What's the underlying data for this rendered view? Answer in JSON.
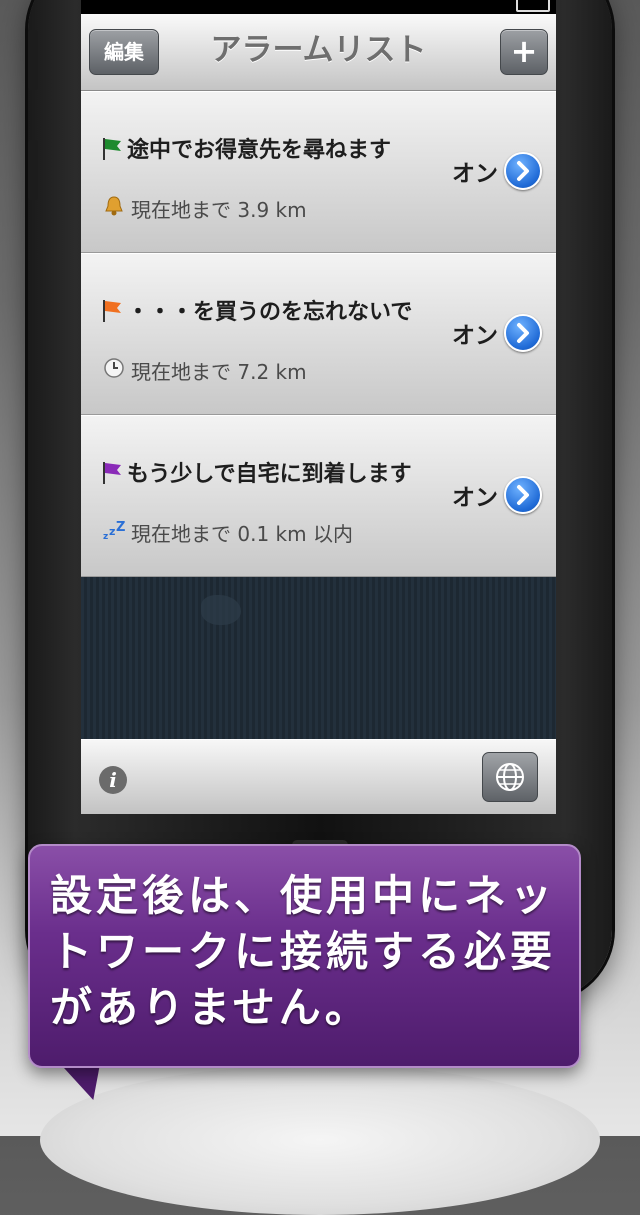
{
  "nav": {
    "edit_label": "編集",
    "title": "アラームリスト",
    "add_label": "+"
  },
  "alarms": [
    {
      "title": "途中でお得意先を尋ねます",
      "flag_color": "#1e8a2e",
      "sub_icon": "bell-icon",
      "subtitle": "現在地まで 3.9 km",
      "state": "オン"
    },
    {
      "title": "・・・を買うのを忘れないで",
      "flag_color": "#f07020",
      "sub_icon": "clock-icon",
      "subtitle": "現在地まで 7.2 km",
      "state": "オン"
    },
    {
      "title": "もう少しで自宅に到着します",
      "flag_color": "#8a2ab8",
      "sub_icon": "sleep-icon",
      "subtitle": "現在地まで 0.1 km 以内",
      "state": "オン"
    }
  ],
  "toolbar": {
    "info_label": "i"
  },
  "caption": {
    "text": "設定後は、使用中にネットワークに接続する必要がありません。"
  },
  "colors": {
    "accent_blue": "#1f6ad6",
    "bubble_purple": "#6a2e8c"
  }
}
